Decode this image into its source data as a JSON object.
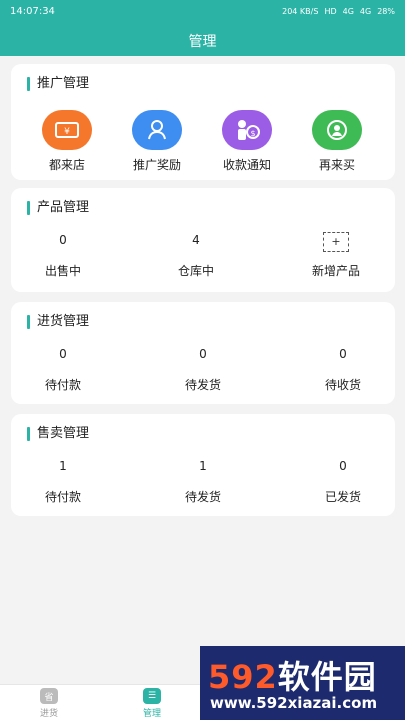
{
  "status_bar": {
    "time": "14:07:34",
    "speed": "204 KB/S",
    "hd": "HD",
    "signal1": "4G",
    "signal2": "4G",
    "battery": "28%"
  },
  "header": {
    "title": "管理"
  },
  "promotion": {
    "title": "推广管理",
    "items": [
      {
        "label": "都来店",
        "icon": "ticket-icon",
        "color": "#f5772b"
      },
      {
        "label": "推广奖励",
        "icon": "user-badge-icon",
        "color": "#3d8ef0"
      },
      {
        "label": "收款通知",
        "icon": "money-person-icon",
        "color": "#9b5de5"
      },
      {
        "label": "再来买",
        "icon": "repeat-user-icon",
        "color": "#3fbb55"
      }
    ]
  },
  "product": {
    "title": "产品管理",
    "stats": [
      {
        "value": "0",
        "label": "出售中"
      },
      {
        "value": "4",
        "label": "仓库中"
      },
      {
        "value": "+",
        "label": "新增产品"
      }
    ]
  },
  "purchase": {
    "title": "进货管理",
    "stats": [
      {
        "value": "0",
        "label": "待付款"
      },
      {
        "value": "0",
        "label": "待发货"
      },
      {
        "value": "0",
        "label": "待收货"
      }
    ]
  },
  "sales": {
    "title": "售卖管理",
    "stats": [
      {
        "value": "1",
        "label": "待付款"
      },
      {
        "value": "1",
        "label": "待发货"
      },
      {
        "value": "0",
        "label": "已发货"
      }
    ]
  },
  "bottom_nav": [
    {
      "label": "进货",
      "icon_text": "省",
      "active": false
    },
    {
      "label": "管理",
      "icon_text": "☰",
      "active": true
    }
  ],
  "watermark": {
    "brand_num": "592",
    "brand_text": "软件园",
    "url": "www.592xiazai.com"
  }
}
